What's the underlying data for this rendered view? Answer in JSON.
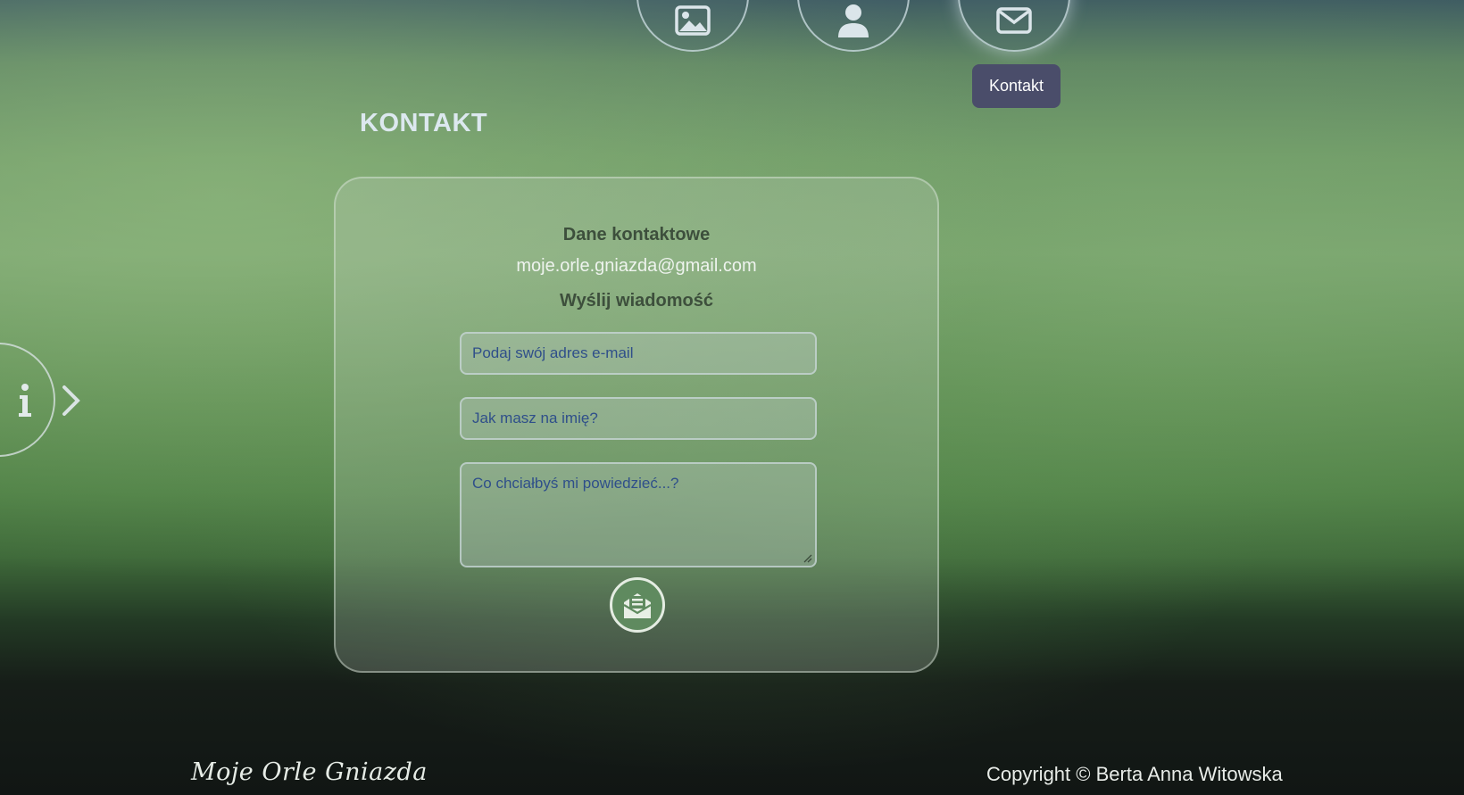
{
  "nav": {
    "items": [
      {
        "icon": "image-icon",
        "label": ""
      },
      {
        "icon": "user-icon",
        "label": ""
      },
      {
        "icon": "envelope-icon",
        "label": "Kontakt"
      }
    ],
    "tooltip": "Kontakt"
  },
  "page": {
    "title": "KONTAKT"
  },
  "contact": {
    "details_heading": "Dane kontaktowe",
    "email": "moje.orle.gniazda@gmail.com",
    "form_heading": "Wyślij wiadomość",
    "email_placeholder": "Podaj swój adres e-mail",
    "name_placeholder": "Jak masz na imię?",
    "message_placeholder": "Co chciałbyś mi powiedzieć...?",
    "send_icon": "envelope-open-icon"
  },
  "side": {
    "info_icon": "info-icon",
    "chevron_icon": "chevron-right-icon"
  },
  "footer": {
    "logo": "Moje Orle Gniazda",
    "copyright": "Copyright © Berta Anna Witowska"
  },
  "colors": {
    "tooltip_bg": "#4a4d6a",
    "heading_text": "#3d4f3c",
    "placeholder_text": "#2f4f8a",
    "send_button_bg": "#5f8a5f"
  }
}
